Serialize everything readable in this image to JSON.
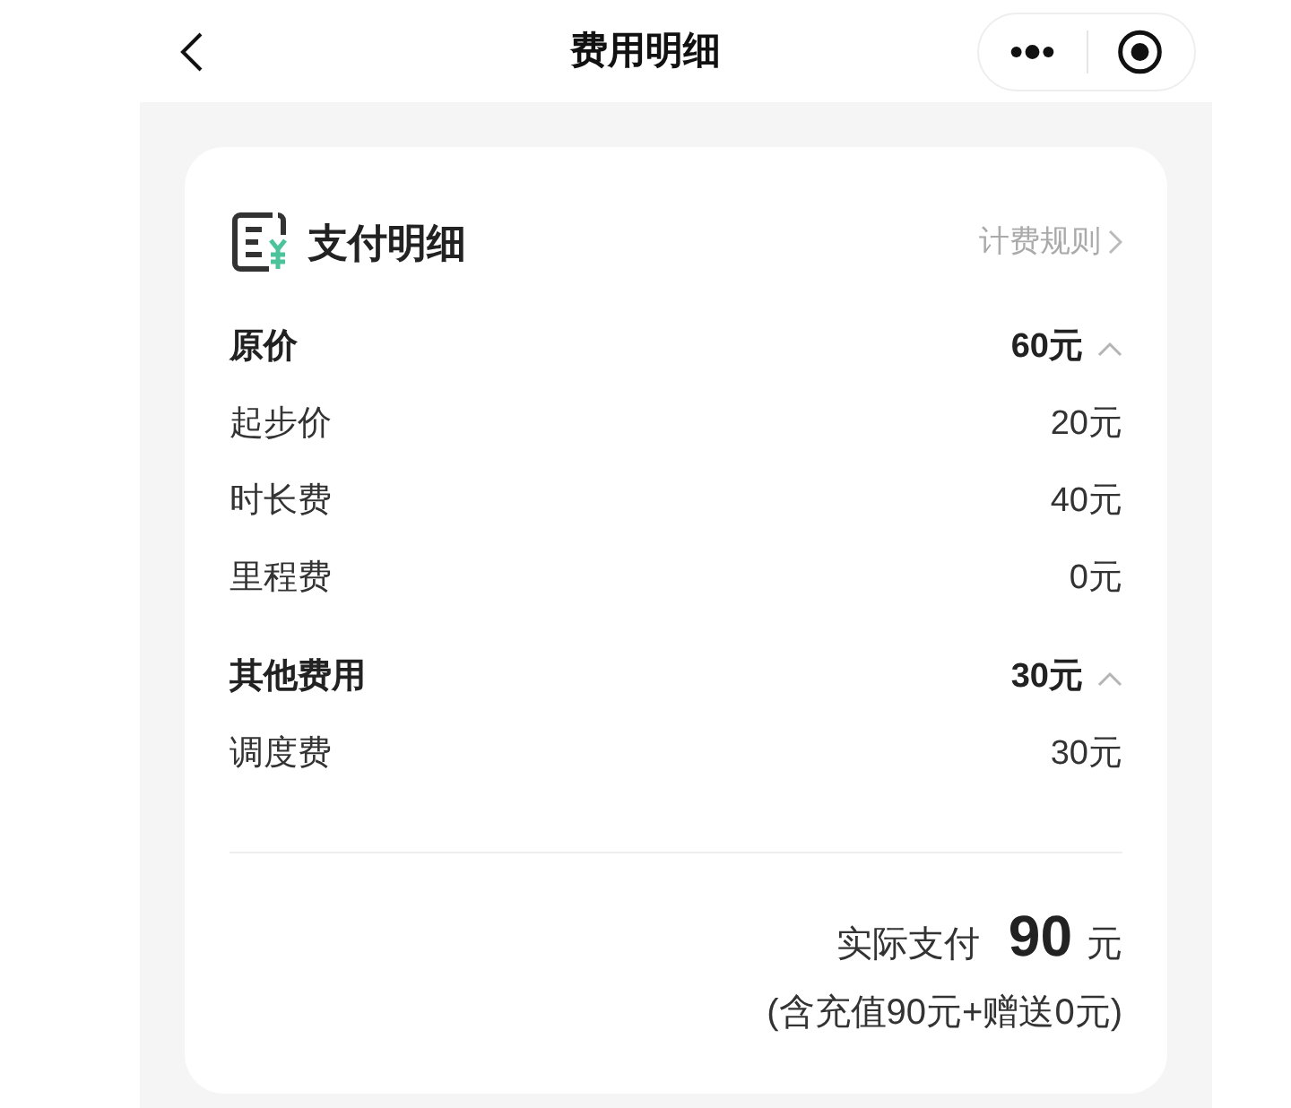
{
  "nav": {
    "title": "费用明细"
  },
  "card": {
    "title": "支付明细",
    "rules_link": "计费规则",
    "sections": [
      {
        "label": "原价",
        "amount": "60元",
        "expanded": true,
        "items": [
          {
            "label": "起步价",
            "amount": "20元"
          },
          {
            "label": "时长费",
            "amount": "40元"
          },
          {
            "label": "里程费",
            "amount": "0元"
          }
        ]
      },
      {
        "label": "其他费用",
        "amount": "30元",
        "expanded": true,
        "items": [
          {
            "label": "调度费",
            "amount": "30元"
          }
        ]
      }
    ],
    "total": {
      "label": "实际支付",
      "amount": "90",
      "unit": "元",
      "note": "(含充值90元+赠送0元)"
    }
  }
}
